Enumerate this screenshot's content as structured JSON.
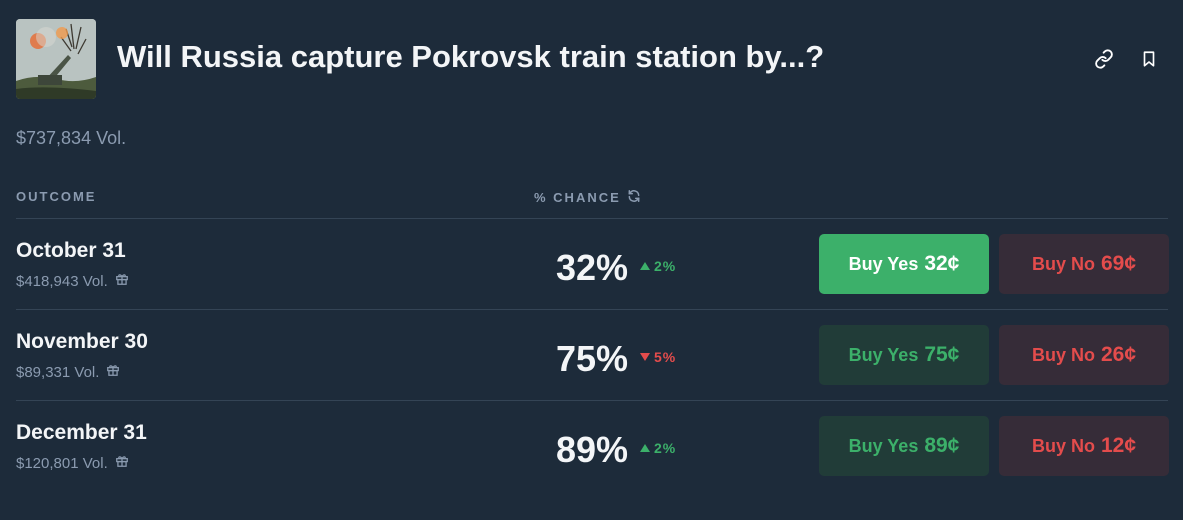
{
  "header": {
    "title": "Will Russia capture Pokrovsk train station by...?",
    "icons": [
      "link-icon",
      "bookmark-icon"
    ]
  },
  "volume": "$737,834 Vol.",
  "columns": {
    "outcome": "OUTCOME",
    "chance": "% CHANCE"
  },
  "colors": {
    "background": "#1d2b3a",
    "yes": "#3cb06a",
    "no": "#e44c4c",
    "yes_bg": "#213c38",
    "no_bg": "#362c38"
  },
  "outcomes": [
    {
      "name": "October 31",
      "volume": "$418,943 Vol.",
      "chance": "32%",
      "delta": "2%",
      "direction": "up",
      "buy_yes_label": "Buy Yes",
      "buy_yes_price": "32¢",
      "buy_no_label": "Buy No",
      "buy_no_price": "69¢"
    },
    {
      "name": "November 30",
      "volume": "$89,331 Vol.",
      "chance": "75%",
      "delta": "5%",
      "direction": "down",
      "buy_yes_label": "Buy Yes",
      "buy_yes_price": "75¢",
      "buy_no_label": "Buy No",
      "buy_no_price": "26¢"
    },
    {
      "name": "December 31",
      "volume": "$120,801 Vol.",
      "chance": "89%",
      "delta": "2%",
      "direction": "up",
      "buy_yes_label": "Buy Yes",
      "buy_yes_price": "89¢",
      "buy_no_label": "Buy No",
      "buy_no_price": "12¢"
    }
  ]
}
